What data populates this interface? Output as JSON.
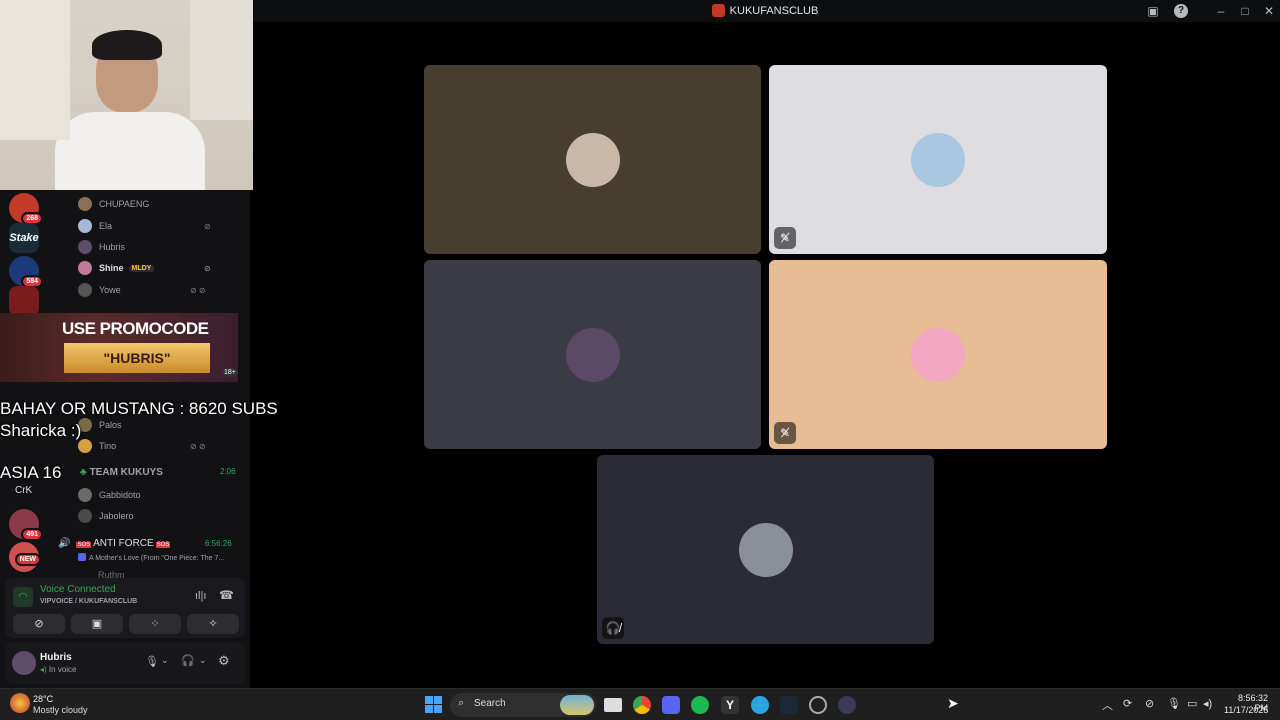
{
  "window": {
    "title": "KUKUFANSCLUB"
  },
  "guilds": [
    {
      "name": "kukufans",
      "badge": "268",
      "color": "#c33b28"
    },
    {
      "name": "Stake",
      "label": "Stake",
      "color": "#1a2c38"
    },
    {
      "name": "tgl-1",
      "badge": "584",
      "color": "#1c3a7a"
    },
    {
      "name": "tgl-2",
      "color": "#7a1c1c"
    },
    {
      "name": "crk",
      "label": "CrK",
      "badge": "3",
      "color": "#2b2d31"
    },
    {
      "name": "server-491",
      "badge": "491",
      "color": "#8a3a4a"
    },
    {
      "name": "new-server",
      "badge": "NEW",
      "color": "#d05050"
    }
  ],
  "voice_users_top": [
    {
      "name": "CHUPAENG",
      "color": "#8c6d5a"
    },
    {
      "name": "Ela",
      "color": "#a7b7d8",
      "icons": "⊘"
    },
    {
      "name": "Hubris",
      "color": "#5d4c6a"
    },
    {
      "name": "Shine",
      "tag": "MLDY",
      "color": "#c07a9a",
      "icons": "⊘"
    },
    {
      "name": "Yowe",
      "color": "#555",
      "icons": "⊘ ⊘"
    }
  ],
  "voice_users_mid": [
    {
      "name": "Palos",
      "color": "#7a6a4a"
    },
    {
      "name": "Tino",
      "color": "#d4a040",
      "icons": "⊘ ⊘"
    }
  ],
  "team_kukuys": {
    "name": "TEAM KUKUYS",
    "time": "2:06",
    "members": [
      {
        "name": "Gabbidoto",
        "color": "#6a6a6a"
      },
      {
        "name": "Jabolero",
        "color": "#4a4a4a"
      }
    ]
  },
  "anti_force": {
    "name": "ANTI FORCE",
    "time": "6:56:26",
    "activity": "A Mother's Love (From \"One Piece: The 7...",
    "next": "Ruthm"
  },
  "promo": {
    "line1": "USE PROMOCODE",
    "line2": "\"HUBRIS\"",
    "age": "18+"
  },
  "overlay": {
    "line1": "BAHAY OR MUSTANG : 8620 SUBS",
    "line2": "Sharicka :)",
    "line3": "ASIA 16"
  },
  "voice_status": {
    "label": "Voice Connected",
    "location": "VIPVOICE / KUKUFANSCLUB"
  },
  "user": {
    "name": "Hubris",
    "status": "In voice"
  },
  "tiles": [
    {
      "bg": "#473e2d",
      "avatar": "#c8b9a6",
      "muted": false
    },
    {
      "bg": "#dedde2",
      "avatar": "#a9c7e0",
      "muted": true
    },
    {
      "bg": "#3b3b45",
      "avatar": "#5a4a66",
      "muted": false
    },
    {
      "bg": "#e8bc94",
      "avatar": "#f2a8c0",
      "muted": true
    },
    {
      "bg": "#2b2b35",
      "avatar": "#8a8f99",
      "muted": true
    }
  ],
  "taskbar": {
    "weather_temp": "28°C",
    "weather_desc": "Mostly cloudy",
    "search": "Search",
    "time": "8:56:32 PM",
    "date": "11/17/2025"
  }
}
